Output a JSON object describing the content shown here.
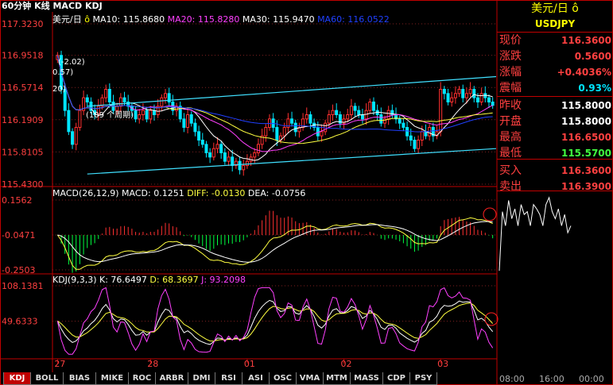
{
  "header": {
    "title": "60分钟 K线 MACD KDJ"
  },
  "main_chart": {
    "legend": {
      "symbol": "美元/日",
      "ma10": "MA10: 115.8680",
      "ma20": "MA20: 115.8280",
      "ma30": "MA30: 115.9470",
      "ma60": "MA60: 116.0522"
    },
    "annotations": {
      "a1": "(-2.02)",
      "a2": "0.57)",
      "a3": "20)",
      "a4": "(109 个周期)"
    },
    "colors": {
      "up": "#ff3030",
      "down": "#00e5ff",
      "ma10": "#ffffff",
      "ma20": "#ff40ff",
      "ma30": "#ffff40",
      "ma60": "#2040ff",
      "channel": "#40e0ff"
    }
  },
  "macd_panel": {
    "legend": {
      "title": "MACD(26,12,9) MACD: 0.1251",
      "diff": "DIFF: -0.0130",
      "dea": "DEA: -0.0756"
    }
  },
  "kdj_panel": {
    "legend": {
      "title": "KDJ(9,3,3)",
      "k": "K: 76.6497",
      "d": "D: 68.3697",
      "j": "J: 93.2098"
    }
  },
  "tabs": [
    "KDJ",
    "BOLL",
    "BIAS",
    "MIKE",
    "ROC",
    "ARBR",
    "DMI",
    "RSI",
    "ASI",
    "OSC",
    "VMA",
    "MTM",
    "MASS",
    "CDP",
    "PSY"
  ],
  "active_tab": "KDJ",
  "quote": {
    "title": "美元/日",
    "code": "USDJPY",
    "rows": [
      {
        "label": "现价",
        "value": "116.3600",
        "color": "#ff4040"
      },
      {
        "label": "涨跌",
        "value": "0.5600",
        "color": "#ff4040"
      },
      {
        "label": "涨幅",
        "value": "+0.4036%",
        "color": "#ff4040"
      },
      {
        "label": "震幅",
        "value": "0.93%",
        "color": "#00e5ff"
      },
      {
        "label": "昨收",
        "value": "115.8000",
        "color": "#ffffff"
      },
      {
        "label": "开盘",
        "value": "115.8000",
        "color": "#ffffff"
      },
      {
        "label": "最高",
        "value": "116.6500",
        "color": "#ff4040"
      },
      {
        "label": "最低",
        "value": "115.5700",
        "color": "#40ff40"
      },
      {
        "label": "买入",
        "value": "116.3600",
        "color": "#ff4040"
      },
      {
        "label": "卖出",
        "value": "116.3900",
        "color": "#ff4040"
      }
    ],
    "time_ticks": [
      "08:00",
      "16:00",
      "00:00"
    ]
  },
  "chart_data": [
    {
      "type": "candlestick",
      "title": "",
      "y_ticks": [
        "117.3230",
        "116.9518",
        "116.5714",
        "116.1909",
        "115.8105",
        "115.4300"
      ],
      "ylim": [
        115.43,
        117.323
      ],
      "x_ticks": [
        "27",
        "28",
        "01",
        "02",
        "03"
      ],
      "x_tick_index": [
        0,
        25,
        51,
        77,
        103
      ],
      "closes": [
        116.95,
        116.55,
        116.3,
        116.05,
        115.9,
        116.1,
        116.3,
        116.45,
        116.4,
        116.3,
        116.25,
        116.35,
        116.45,
        116.55,
        116.4,
        116.3,
        116.35,
        116.45,
        116.4,
        116.35,
        116.3,
        116.2,
        116.25,
        116.3,
        116.2,
        116.3,
        116.25,
        116.35,
        116.45,
        116.5,
        116.4,
        116.3,
        116.35,
        116.2,
        116.1,
        116.25,
        116.15,
        116.05,
        115.95,
        115.9,
        115.8,
        115.75,
        115.85,
        115.9,
        115.8,
        115.7,
        115.75,
        115.65,
        115.7,
        115.6,
        115.65,
        115.7,
        115.75,
        115.8,
        115.9,
        116.0,
        116.1,
        116.2,
        116.1,
        115.95,
        116.0,
        116.1,
        116.2,
        116.15,
        116.05,
        116.1,
        116.2,
        116.25,
        116.15,
        116.1,
        116.0,
        116.05,
        116.15,
        116.25,
        116.3,
        116.25,
        116.15,
        116.2,
        116.25,
        116.35,
        116.3,
        116.25,
        116.2,
        116.3,
        116.4,
        116.3,
        116.25,
        116.15,
        116.2,
        116.3,
        116.25,
        116.2,
        116.15,
        116.1,
        116.0,
        115.95,
        115.85,
        115.95,
        116.05,
        116.0,
        116.1,
        116.0,
        116.05,
        116.55,
        116.5,
        116.4,
        116.45,
        116.5,
        116.55,
        116.45,
        116.5,
        116.55,
        116.45,
        116.4,
        116.5,
        116.45,
        116.4,
        116.36
      ],
      "channel": [
        {
          "from": 115.55,
          "to": 115.85
        },
        {
          "from": 116.35,
          "to": 116.7
        }
      ],
      "ma_series": [
        "MA10",
        "MA20",
        "MA30",
        "MA60"
      ]
    },
    {
      "type": "bar",
      "title": "MACD(26,12,9)",
      "y_ticks": [
        "0.1562",
        "-0.0471",
        "-0.2503"
      ],
      "ylim": [
        -0.2503,
        0.1562
      ],
      "macd_last": 0.1251,
      "diff_last": -0.013,
      "dea_last": -0.0756
    },
    {
      "type": "line",
      "title": "KDJ(9,3,3)",
      "y_ticks": [
        "108.1381",
        "49.6333"
      ],
      "ylim": [
        -10,
        108.1381
      ],
      "k_last": 76.6497,
      "d_last": 68.3697,
      "j_last": 93.2098
    },
    {
      "type": "line",
      "title": "",
      "x_ticks": [
        "08:00",
        "16:00",
        "00:00"
      ],
      "values": [
        115.98,
        116.4,
        116.3,
        116.48,
        116.35,
        116.42,
        116.3,
        116.45,
        116.38,
        116.4,
        116.3,
        116.45,
        116.42,
        116.38,
        116.3,
        116.45,
        116.5,
        116.4,
        116.35,
        116.42,
        116.3,
        116.38,
        116.25,
        116.3
      ]
    }
  ]
}
